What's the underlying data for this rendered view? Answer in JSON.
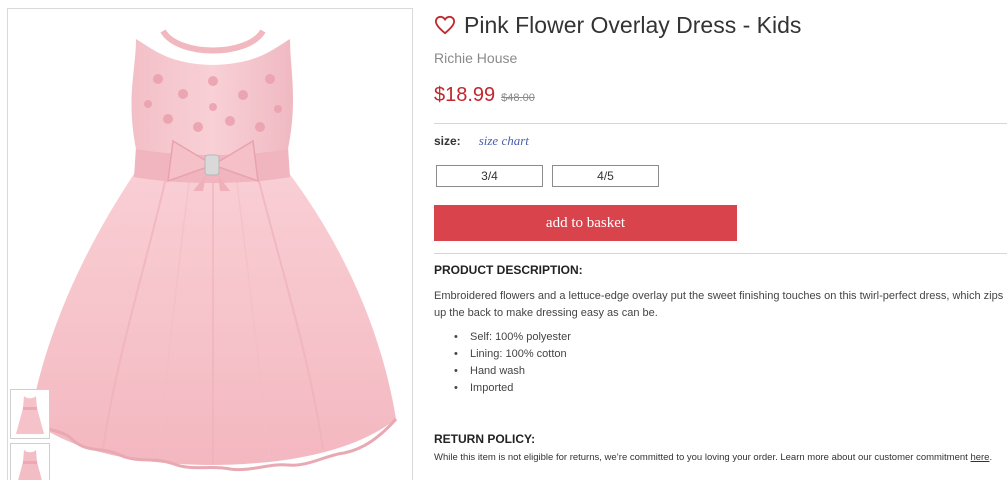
{
  "product": {
    "title": "Pink Flower Overlay Dress - Kids",
    "brand": "Richie House",
    "price": "$18.99",
    "original_price": "$48.00"
  },
  "size": {
    "label": "size:",
    "chart_link": "size chart",
    "options": [
      "3/4",
      "4/5"
    ]
  },
  "actions": {
    "add_to_basket": "add to basket"
  },
  "description": {
    "heading": "PRODUCT DESCRIPTION:",
    "text": "Embroidered flowers and a lettuce-edge overlay put the sweet finishing touches on this twirl-perfect dress, which zips up the back to make dressing easy as can be.",
    "features": [
      "Self: 100% polyester",
      "Lining: 100% cotton",
      "Hand wash",
      "Imported"
    ]
  },
  "return_policy": {
    "heading": "RETURN POLICY:",
    "text": "While this item is not eligible for returns, we’re committed to you loving your order. Learn more about our customer commitment ",
    "link_text": "here",
    "suffix": "."
  },
  "icons": {
    "favorite": "heart-outline-icon"
  },
  "colors": {
    "accent_red": "#c1272d",
    "button_red": "#d9434b",
    "link_blue": "#4a5fa8",
    "dress_pink": "#f6c6cc"
  }
}
